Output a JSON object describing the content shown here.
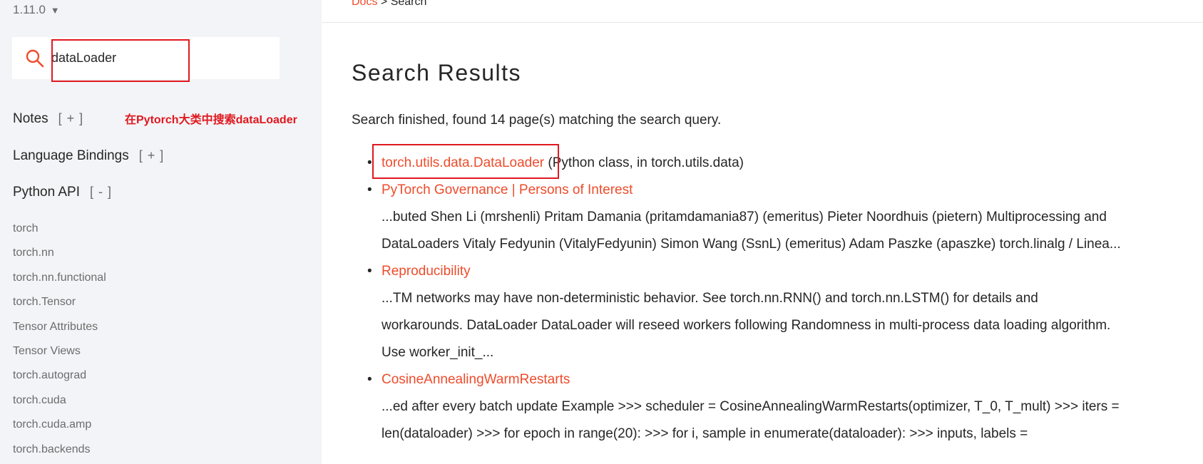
{
  "sidebar": {
    "version": "1.11.0",
    "version_caret": "▼",
    "search": {
      "value": "dataLoader",
      "icon": "search-icon"
    },
    "annotation": "在Pytorch大类中搜索dataLoader",
    "sections": [
      {
        "label": "Notes",
        "toggle": "[ + ]"
      },
      {
        "label": "Language Bindings",
        "toggle": "[ + ]"
      },
      {
        "label": "Python API",
        "toggle": "[ - ]"
      }
    ],
    "items": [
      "torch",
      "torch.nn",
      "torch.nn.functional",
      "torch.Tensor",
      "Tensor Attributes",
      "Tensor Views",
      "torch.autograd",
      "torch.cuda",
      "torch.cuda.amp",
      "torch.backends"
    ]
  },
  "main": {
    "breadcrumb": {
      "link": "Docs",
      "separator": ">",
      "current": "Search"
    },
    "title": "Search Results",
    "summary": "Search finished, found 14 page(s) matching the search query.",
    "results": [
      {
        "link": "torch.utils.data.DataLoader",
        "suffix": "(Python class, in torch.utils.data)",
        "snippet": ""
      },
      {
        "link": "PyTorch Governance | Persons of Interest",
        "suffix": "",
        "snippet": "...buted Shen Li (mrshenli) Pritam Damania (pritamdamania87) (emeritus) Pieter Noordhuis (pietern) Multiprocessing and DataLoaders Vitaly Fedyunin (VitalyFedyunin) Simon Wang (SsnL) (emeritus) Adam Paszke (apaszke) torch.linalg / Linea..."
      },
      {
        "link": "Reproducibility",
        "suffix": "",
        "snippet": "...TM networks may have non-deterministic behavior. See torch.nn.RNN() and torch.nn.LSTM() for details and workarounds. DataLoader DataLoader will reseed workers following Randomness in multi-process data loading algorithm. Use worker_init_..."
      },
      {
        "link": "CosineAnnealingWarmRestarts",
        "suffix": "",
        "snippet": "...ed after every batch update Example >>> scheduler = CosineAnnealingWarmRestarts(optimizer, T_0, T_mult) >>> iters = len(dataloader) >>> for epoch in range(20): >>> for i, sample in enumerate(dataloader): >>> inputs, labels ="
      }
    ],
    "bullet": "•"
  },
  "colors": {
    "accent": "#ee4c2c",
    "annotation_red": "#e0181f",
    "sidebar_bg": "#f3f4f7",
    "text": "#262626",
    "muted": "#6c6c6d"
  }
}
